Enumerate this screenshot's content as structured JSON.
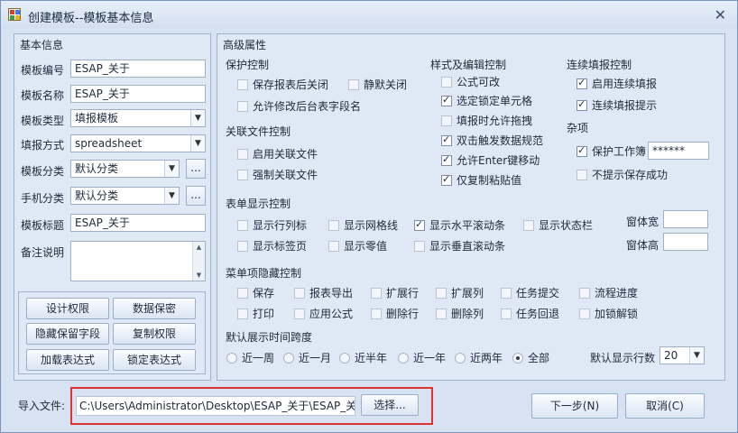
{
  "window": {
    "title": "创建模板--模板基本信息",
    "close_label": "✕"
  },
  "basic": {
    "group_title": "基本信息",
    "fields": {
      "code_label": "模板编号",
      "code_value": "ESAP_关于",
      "name_label": "模板名称",
      "name_value": "ESAP_关于",
      "type_label": "模板类型",
      "type_value": "填报模板",
      "mode_label": "填报方式",
      "mode_value": "spreadsheet",
      "category_label": "模板分类",
      "category_value": "默认分类",
      "mobile_label": "手机分类",
      "mobile_value": "默认分类",
      "caption_label": "模板标题",
      "caption_value": "ESAP_关于",
      "remark_label": "备注说明"
    },
    "ellipsis": "...",
    "buttons": {
      "design_perm": "设计权限",
      "data_secret": "数据保密",
      "hide_fields": "隐藏保留字段",
      "copy_perm": "复制权限",
      "load_expr": "加载表达式",
      "lock_expr": "锁定表达式"
    }
  },
  "advanced": {
    "group_title": "高级属性",
    "protect": {
      "title": "保护控制",
      "save_close": "保存报表后关闭",
      "silent_close": "静默关闭",
      "allow_edit_field": "允许修改后台表字段名"
    },
    "linked": {
      "title": "关联文件控制",
      "enable": "启用关联文件",
      "force": "强制关联文件"
    },
    "style": {
      "title": "样式及编辑控制",
      "formula": "公式可改",
      "lock_cell": "选定锁定单元格",
      "drag": "填报时允许拖拽",
      "dblclick": "双击触发数据规范",
      "enter_move": "允许Enter键移动",
      "paste_value": "仅复制粘贴值"
    },
    "continuous": {
      "title": "连续填报控制",
      "enable": "启用连续填报",
      "prompt": "连续填报提示"
    },
    "misc": {
      "title": "杂项",
      "protect_sheet": "保护工作簿",
      "password": "******",
      "no_save_prompt": "不提示保存成功"
    },
    "display": {
      "title": "表单显示控制",
      "row_col": "显示行列标",
      "gridlines": "显示网格线",
      "hscroll": "显示水平滚动条",
      "statusbar": "显示状态栏",
      "tabs": "显示标签页",
      "zero": "显示零值",
      "vscroll": "显示垂直滚动条",
      "win_width": "窗体宽",
      "win_height": "窗体高"
    },
    "menu": {
      "title": "菜单项隐藏控制",
      "save": "保存",
      "export": "报表导出",
      "expand_row": "扩展行",
      "expand_col": "扩展列",
      "submit": "任务提交",
      "progress": "流程进度",
      "print": "打印",
      "apply_formula": "应用公式",
      "del_row": "删除行",
      "del_col": "删除列",
      "rollback": "任务回退",
      "unlock": "加锁解锁"
    },
    "span": {
      "title": "默认展示时间跨度",
      "week": "近一周",
      "month": "近一月",
      "half_year": "近半年",
      "year": "近一年",
      "two_years": "近两年",
      "all": "全部",
      "rows_label": "默认显示行数",
      "rows_value": "20"
    }
  },
  "footer": {
    "import_label": "导入文件:",
    "import_path": "C:\\Users\\Administrator\\Desktop\\ESAP_关于\\ESAP_关于.",
    "choose": "选择...",
    "next": "下一步(N)",
    "cancel": "取消(C)"
  }
}
